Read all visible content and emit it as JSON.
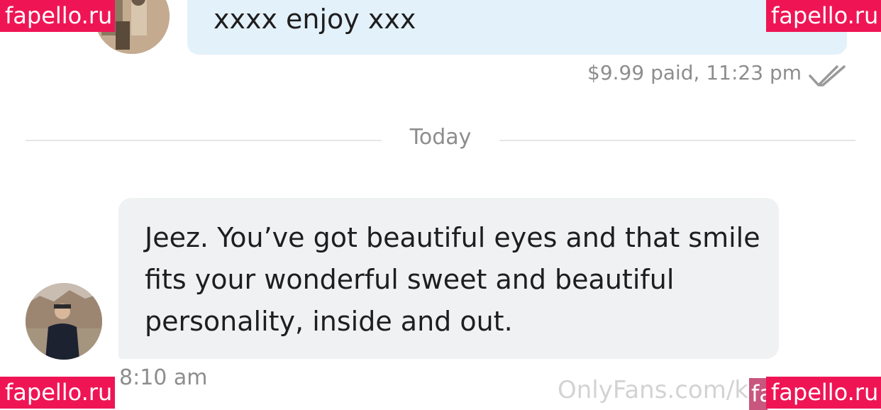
{
  "sent_message": {
    "text": "xxxx enjoy xxx",
    "price_time": "$9.99 paid, 11:23 pm",
    "status_icon": "double-check-icon"
  },
  "divider": {
    "label": "Today"
  },
  "received_message": {
    "text": "Jeez. You’ve got beautiful eyes and that smile fits your wonderful sweet and beautiful personality, inside and out.",
    "time": "8:10 am"
  },
  "watermarks": {
    "onlyfans": "OnlyFans.com/k",
    "fapello": "fapello.ru",
    "fapello_partial": "fa"
  },
  "colors": {
    "sent_bubble": "#e3f1fb",
    "received_bubble": "#f0f1f3",
    "badge": "#ef1555",
    "meta_text": "#8d8d8d"
  }
}
